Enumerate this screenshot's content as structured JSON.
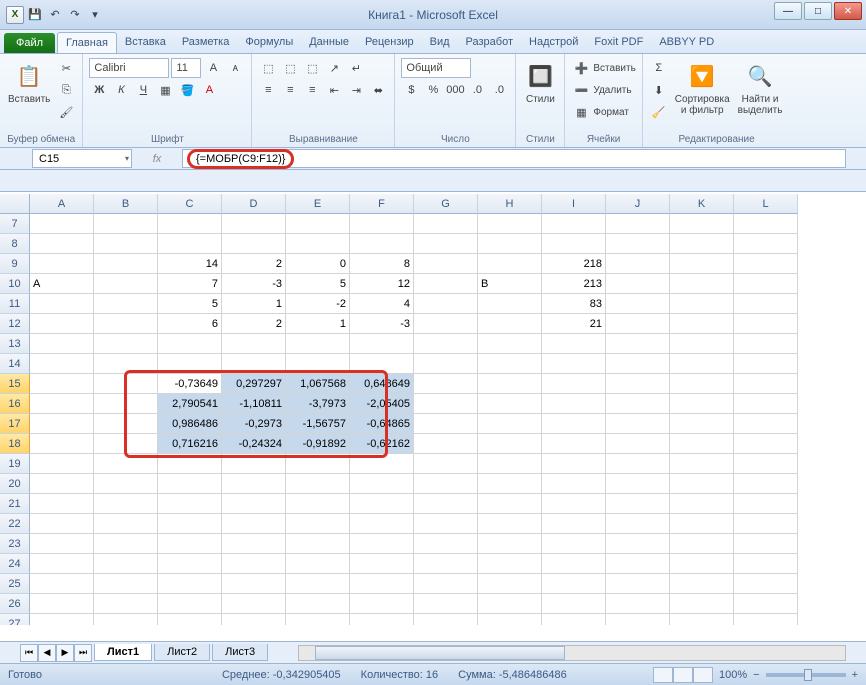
{
  "title": "Книга1 - Microsoft Excel",
  "tabs": {
    "file": "Файл",
    "items": [
      "Главная",
      "Вставка",
      "Разметка",
      "Формулы",
      "Данные",
      "Рецензир",
      "Вид",
      "Разработ",
      "Надстрой",
      "Foxit PDF",
      "ABBYY PD"
    ],
    "active": 0
  },
  "ribbon": {
    "clipboard": {
      "label": "Буфер обмена",
      "paste": "Вставить"
    },
    "font": {
      "label": "Шрифт",
      "name": "Calibri",
      "size": "11"
    },
    "align": {
      "label": "Выравнивание"
    },
    "number": {
      "label": "Число",
      "format": "Общий"
    },
    "styles": {
      "label": "Стили",
      "btn": "Стили"
    },
    "cells_grp": {
      "label": "Ячейки",
      "insert": "Вставить",
      "delete": "Удалить",
      "format": "Формат"
    },
    "editing": {
      "label": "Редактирование",
      "sort": "Сортировка\nи фильтр",
      "find": "Найти и\nвыделить"
    }
  },
  "namebox": "C15",
  "formula": "{=МОБР(C9:F12)}",
  "cols": [
    "A",
    "B",
    "C",
    "D",
    "E",
    "F",
    "G",
    "H",
    "I",
    "J",
    "K",
    "L"
  ],
  "rows_start": 7,
  "rows_count": 22,
  "selected_rows": [
    15,
    16,
    17,
    18
  ],
  "cells": {
    "9": {
      "C": "14",
      "D": "2",
      "E": "0",
      "F": "8",
      "I": "218"
    },
    "10": {
      "A": "A",
      "C": "7",
      "D": "-3",
      "E": "5",
      "F": "12",
      "H": "B",
      "I": "213"
    },
    "11": {
      "C": "5",
      "D": "1",
      "E": "-2",
      "F": "4",
      "I": "83"
    },
    "12": {
      "C": "6",
      "D": "2",
      "E": "1",
      "F": "-3",
      "I": "21"
    },
    "15": {
      "C": "-0,73649",
      "D": "0,297297",
      "E": "1,067568",
      "F": "0,648649"
    },
    "16": {
      "C": "2,790541",
      "D": "-1,10811",
      "E": "-3,7973",
      "F": "-2,05405"
    },
    "17": {
      "C": "0,986486",
      "D": "-0,2973",
      "E": "-1,56757",
      "F": "-0,64865"
    },
    "18": {
      "C": "0,716216",
      "D": "-0,24324",
      "E": "-0,91892",
      "F": "-0,62162"
    }
  },
  "selection_range": [
    "C",
    15,
    "F",
    18
  ],
  "sheets": [
    "Лист1",
    "Лист2",
    "Лист3"
  ],
  "status": {
    "ready": "Готово",
    "avg_l": "Среднее:",
    "avg_v": "-0,342905405",
    "cnt_l": "Количество:",
    "cnt_v": "16",
    "sum_l": "Сумма:",
    "sum_v": "-5,486486486",
    "zoom": "100%"
  },
  "icons": {
    "save": "💾",
    "undo": "↶",
    "redo": "↷",
    "min": "—",
    "max": "□",
    "close": "✕",
    "fx": "fx",
    "dd": "▾"
  }
}
